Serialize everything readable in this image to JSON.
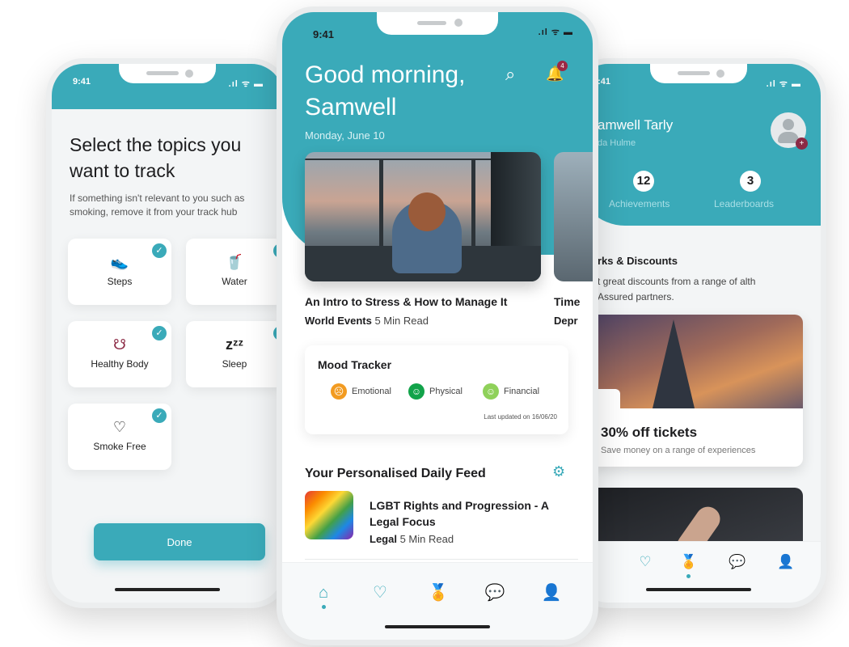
{
  "colors": {
    "accent": "#3aaab9",
    "maroon": "#8c2a45",
    "emotional": "#f29b21",
    "physical": "#12a34a",
    "financial": "#8fd15a"
  },
  "left_phone": {
    "time": "9:41",
    "title": "Select the topics you want to track",
    "subtitle": "If something isn't relevant to you such as smoking, remove it from your track hub",
    "topics": [
      {
        "label": "Steps",
        "icon": "shoe-icon",
        "checked": true
      },
      {
        "label": "Water",
        "icon": "glass-icon",
        "checked": true
      },
      {
        "label": "Healthy Body",
        "icon": "body-icon",
        "checked": true
      },
      {
        "label": "Sleep",
        "icon": "zzz-icon",
        "checked": true
      },
      {
        "label": "Smoke Free",
        "icon": "heart-icon",
        "checked": true
      }
    ],
    "done_label": "Done"
  },
  "center_phone": {
    "time": "9:41",
    "greeting": "Good morning, Samwell",
    "date": "Monday, June 10",
    "notification_count": "4",
    "articles": [
      {
        "title": "An Intro to Stress & How to Manage It",
        "category": "World Events",
        "read_time": "5 Min Read"
      },
      {
        "title": "Time",
        "category": "Depr",
        "read_time": ""
      }
    ],
    "mood_tracker": {
      "title": "Mood Tracker",
      "items": [
        {
          "label": "Emotional"
        },
        {
          "label": "Physical"
        },
        {
          "label": "Financial"
        }
      ],
      "updated": "Last updated on 16/06/20"
    },
    "feed": {
      "title": "Your Personalised Daily Feed",
      "items": [
        {
          "title": "LGBT Rights and Progression - A Legal Focus",
          "category": "Legal",
          "read_time": "5 Min Read"
        }
      ]
    },
    "tabs": [
      {
        "icon": "home-icon"
      },
      {
        "icon": "heart-icon"
      },
      {
        "icon": "award-icon"
      },
      {
        "icon": "chat-icon"
      },
      {
        "icon": "profile-icon"
      }
    ]
  },
  "right_phone": {
    "time": "9:41",
    "name": "amwell Tarly",
    "location": "da Hulme",
    "stats": [
      {
        "value": "12",
        "label": "Achievements"
      },
      {
        "value": "3",
        "label": "Leaderboards"
      }
    ],
    "perks_title": "rks & Discounts",
    "perks_desc": "t great discounts from a range of alth Assured partners.",
    "offer_title": "30% off tickets",
    "offer_sub": "Save money on a range of experiences",
    "tabs": [
      {
        "icon": "home-icon"
      },
      {
        "icon": "heart-icon"
      },
      {
        "icon": "award-icon"
      },
      {
        "icon": "chat-icon"
      },
      {
        "icon": "profile-icon"
      }
    ]
  }
}
